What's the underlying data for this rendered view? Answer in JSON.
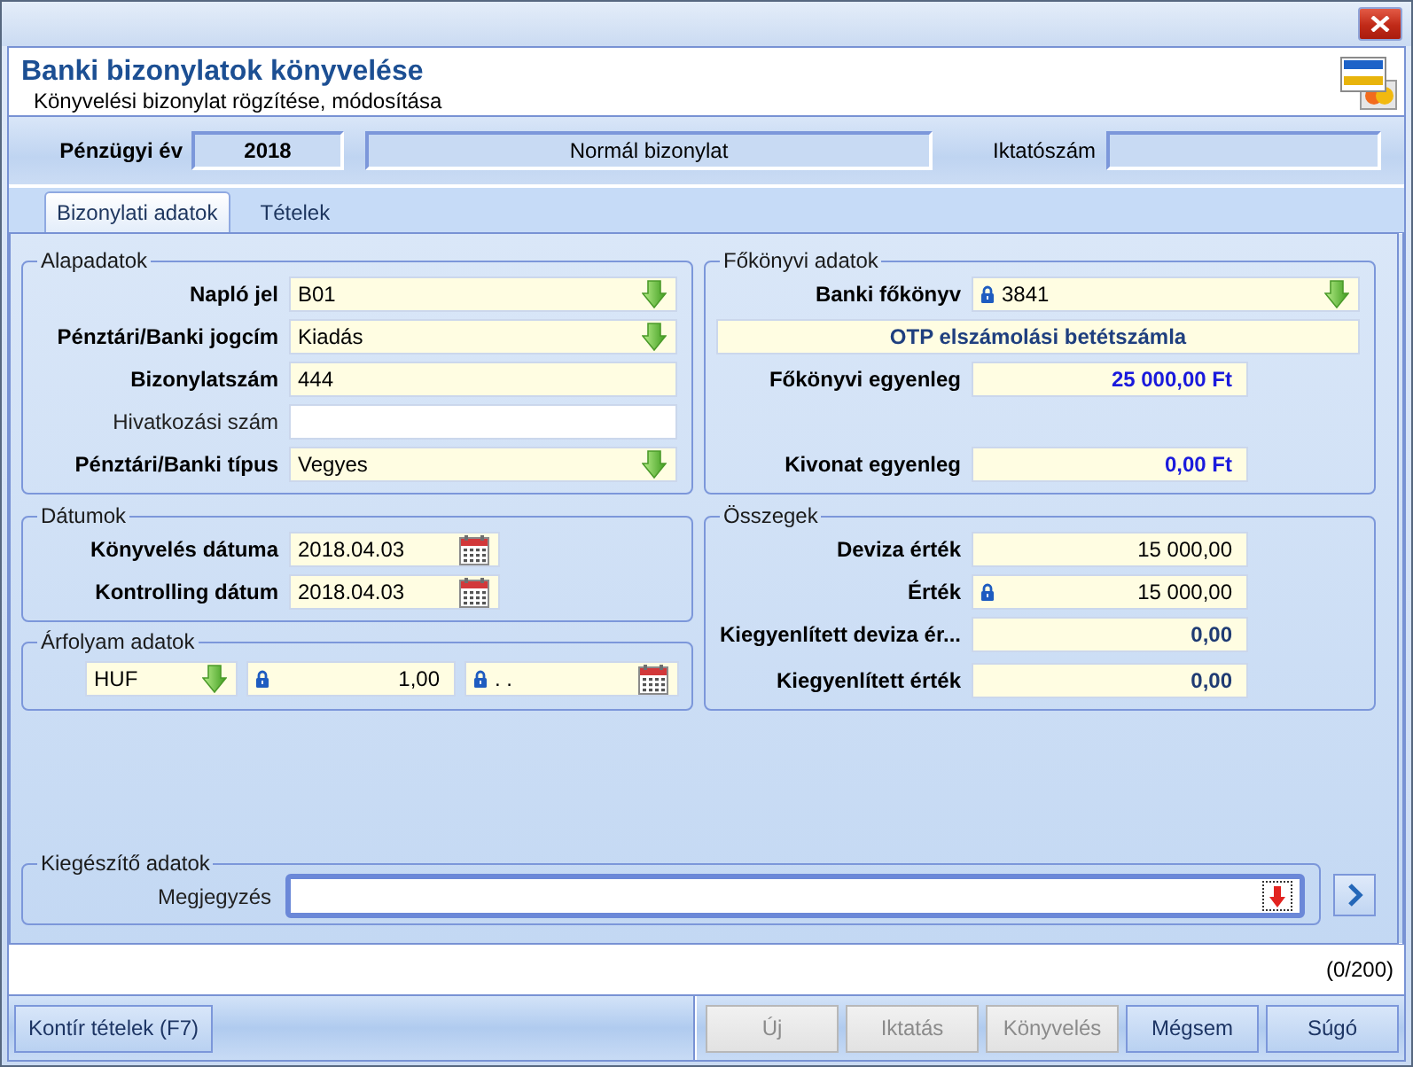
{
  "window": {
    "title": "Banki bizonylatok könyvelése",
    "subtitle": "Könyvelési bizonylat rögzítése, módosítása"
  },
  "header_bar": {
    "fiscal_year_label": "Pénzügyi év",
    "fiscal_year": "2018",
    "document_type": "Normál bizonylat",
    "filing_number_label": "Iktatószám"
  },
  "tabs": [
    {
      "label": "Bizonylati adatok",
      "selected": true
    },
    {
      "label": "Tételek",
      "selected": false
    }
  ],
  "basic_data": {
    "title": "Alapadatok",
    "rows": [
      {
        "label": "Napló jel",
        "kind": "dropdown",
        "value": "B01",
        "required": true,
        "locked": false
      },
      {
        "label": "Pénztári/Banki jogcím",
        "kind": "dropdown",
        "value": "Kiadás",
        "required": true,
        "locked": false
      },
      {
        "label": "Bizonylatszám",
        "kind": "text",
        "value": "444",
        "required": true,
        "locked": false
      },
      {
        "label": "Hivatkozási szám",
        "kind": "text",
        "required": false,
        "locked": false
      },
      {
        "label": "Pénztári/Banki típus",
        "kind": "dropdown",
        "value": "Vegyes",
        "required": true,
        "locked": false
      }
    ]
  },
  "dates": {
    "title": "Dátumok",
    "rows": [
      {
        "label": "Könyvelés dátuma",
        "kind": "date",
        "value": "2018.04.03",
        "required": true,
        "locked": false
      },
      {
        "label": "Kontrolling dátum",
        "kind": "date",
        "value": "2018.04.03",
        "required": true,
        "locked": false
      }
    ]
  },
  "exchange_rate": {
    "title": "Árfolyam adatok",
    "fields": [
      {
        "kind": "dropdown",
        "value": "HUF",
        "locked": false
      },
      {
        "kind": "amount",
        "value": "1,00",
        "locked": true,
        "emphasized": false
      },
      {
        "kind": "date",
        "value": ". .",
        "locked": true
      }
    ]
  },
  "ledger": {
    "title": "Főkönyvi adatok",
    "rows": [
      {
        "label": "Banki főkönyv",
        "kind": "dropdown",
        "value": "3841",
        "required": true,
        "locked": true
      },
      {
        "kind": "description",
        "value": "OTP elszámolási betétszámla"
      },
      {
        "label": "Főkönyvi egyenleg",
        "kind": "balance",
        "value": "25 000,00 Ft",
        "required": true,
        "locked": false
      },
      {
        "label": "Kivonat egyenleg",
        "kind": "balance",
        "value": "0,00 Ft",
        "required": true,
        "locked": false
      }
    ]
  },
  "totals": {
    "title": "Összegek",
    "rows": [
      {
        "label": "Deviza érték",
        "kind": "amount",
        "value": "15 000,00",
        "required": true,
        "locked": false,
        "emphasized": false
      },
      {
        "label": "Érték",
        "kind": "amount",
        "value": "15 000,00",
        "required": true,
        "locked": true,
        "emphasized": false
      },
      {
        "label": "Kiegyenlített deviza ér...",
        "kind": "amount",
        "value": "0,00",
        "required": true,
        "locked": false,
        "emphasized": true
      },
      {
        "label": "Kiegyenlített érték",
        "kind": "amount",
        "value": "0,00",
        "required": true,
        "locked": false,
        "emphasized": true
      }
    ]
  },
  "extra": {
    "title": "Kiegészítő adatok",
    "note_label": "Megjegyzés",
    "focused": true
  },
  "counter": "(0/200)",
  "buttons": {
    "left": [
      {
        "label": "Kontír tételek (F7)",
        "disabled": false
      }
    ],
    "right": [
      {
        "label": "Új",
        "disabled": true
      },
      {
        "label": "Iktatás",
        "disabled": true
      },
      {
        "label": "Könyvelés",
        "disabled": true
      },
      {
        "label": "Mégsem",
        "disabled": false
      },
      {
        "label": "Súgó",
        "disabled": false
      }
    ]
  }
}
